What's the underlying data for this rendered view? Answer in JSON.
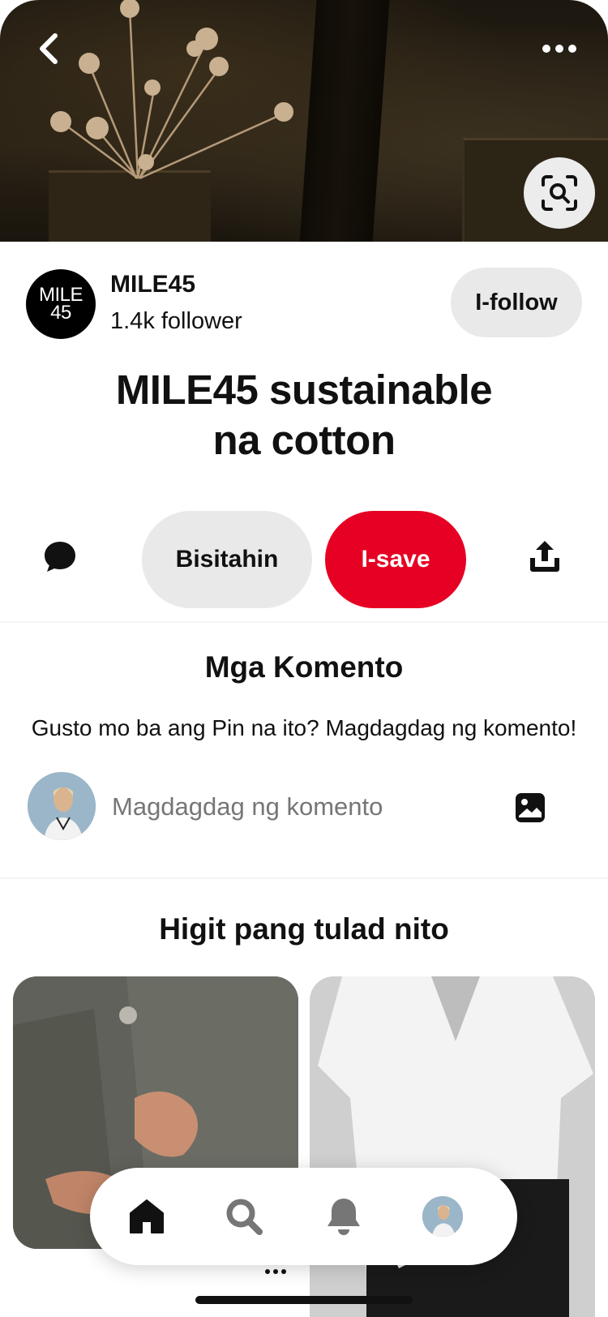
{
  "hero": {
    "back_icon": "chevron-left-icon",
    "more_icon": "ellipsis-icon",
    "lens_icon": "visual-search-icon"
  },
  "creator": {
    "logo_line1": "MILE",
    "logo_line2": "45",
    "name": "MILE45",
    "followers": "1.4k follower",
    "follow_label": "I-follow"
  },
  "pin": {
    "title_line1": "MILE45 sustainable",
    "title_line2": "na cotton"
  },
  "actions": {
    "comment_icon": "speech-bubble-icon",
    "visit_label": "Bisitahin",
    "save_label": "I-save",
    "share_icon": "share-upload-icon"
  },
  "comments": {
    "title": "Mga Komento",
    "prompt": "Gusto mo ba ang Pin na ito? Magdagdag ng komento!",
    "input_placeholder": "Magdagdag ng komento",
    "photo_icon": "image-icon"
  },
  "more_like_this": {
    "title": "Higit pang tulad nito",
    "more_icon": "ellipsis-icon"
  },
  "bottom_nav": {
    "items": [
      "home-icon",
      "search-icon",
      "bell-icon",
      "profile-avatar"
    ]
  },
  "colors": {
    "save_red": "#e60023",
    "button_gray": "#e9e9e9"
  }
}
